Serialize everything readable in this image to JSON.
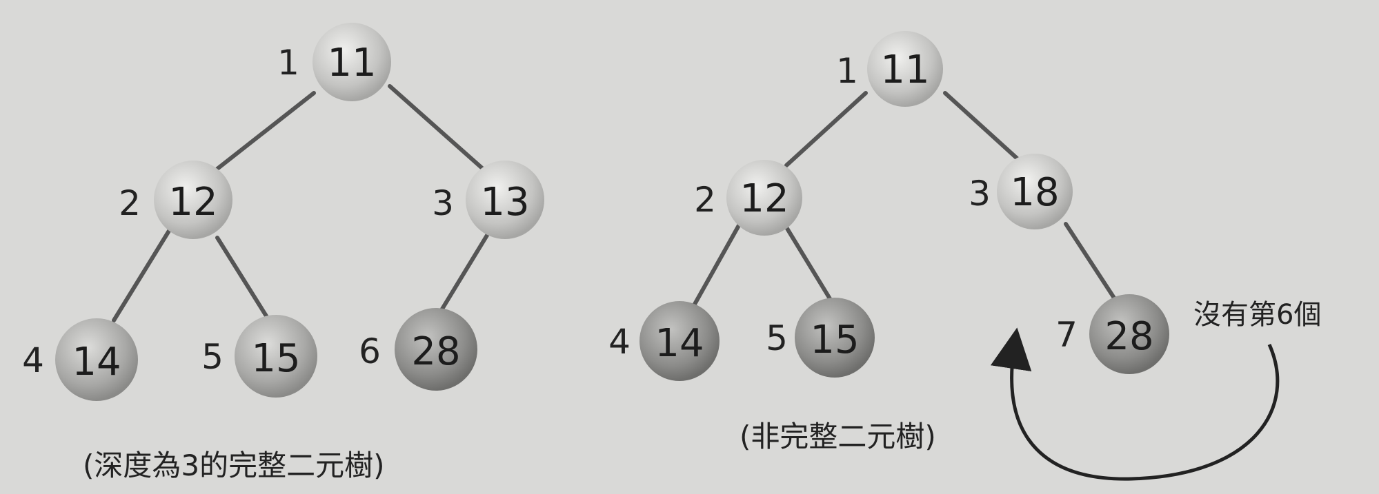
{
  "trees": [
    {
      "caption": "(深度為3的完整二元樹)",
      "nodes": [
        {
          "index": "1",
          "value": "11",
          "level": 1,
          "shade": "light"
        },
        {
          "index": "2",
          "value": "12",
          "level": 2,
          "shade": "light"
        },
        {
          "index": "3",
          "value": "13",
          "level": 2,
          "shade": "light"
        },
        {
          "index": "4",
          "value": "14",
          "level": 3,
          "shade": "mid"
        },
        {
          "index": "5",
          "value": "15",
          "level": 3,
          "shade": "mid"
        },
        {
          "index": "6",
          "value": "28",
          "level": 3,
          "shade": "dark"
        }
      ],
      "edges": [
        [
          "1",
          "2"
        ],
        [
          "1",
          "3"
        ],
        [
          "2",
          "4"
        ],
        [
          "2",
          "5"
        ],
        [
          "3",
          "6"
        ]
      ]
    },
    {
      "caption": "(非完整二元樹)",
      "nodes": [
        {
          "index": "1",
          "value": "11",
          "level": 1,
          "shade": "light"
        },
        {
          "index": "2",
          "value": "12",
          "level": 2,
          "shade": "light"
        },
        {
          "index": "3",
          "value": "18",
          "level": 2,
          "shade": "light"
        },
        {
          "index": "4",
          "value": "14",
          "level": 3,
          "shade": "dark"
        },
        {
          "index": "5",
          "value": "15",
          "level": 3,
          "shade": "dark"
        },
        {
          "index": "7",
          "value": "28",
          "level": 3,
          "shade": "dark"
        }
      ],
      "edges": [
        [
          "1",
          "2"
        ],
        [
          "1",
          "3"
        ],
        [
          "2",
          "4"
        ],
        [
          "2",
          "5"
        ],
        [
          "3",
          "7"
        ]
      ],
      "annotation": "沒有第6個"
    }
  ],
  "colors": {
    "light": "#c4c4c2",
    "mid": "#a8a8a6",
    "dark": "#8c8c8a"
  }
}
